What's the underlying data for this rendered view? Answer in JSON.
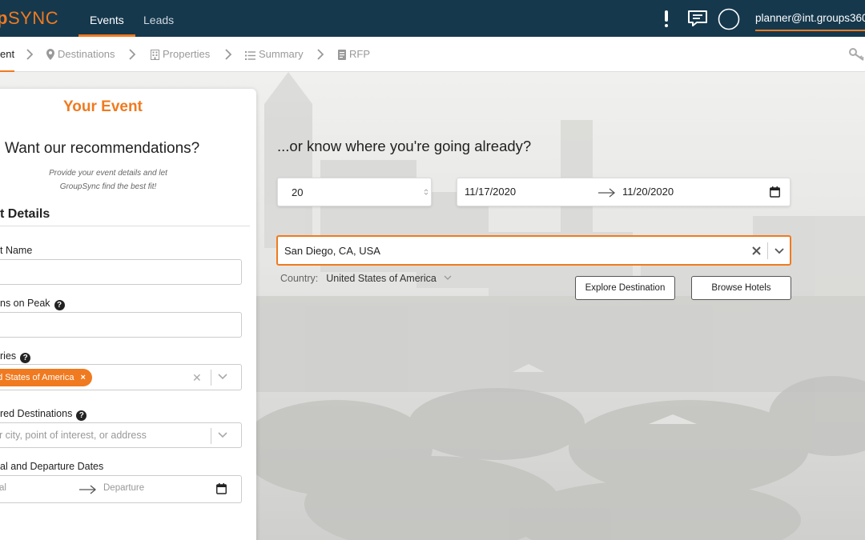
{
  "app": {
    "logo_part1": "p",
    "logo_part2": "SYNC",
    "brand_color": "#f07a1f",
    "nav_color": "#15384d"
  },
  "topnav": {
    "tabs": [
      {
        "label": "Events",
        "active": true
      },
      {
        "label": "Leads",
        "active": false
      }
    ],
    "icons": [
      "alert-icon",
      "chat-icon",
      "avatar-circle-icon"
    ],
    "user": "planner@int.groups360"
  },
  "breadcrumb": {
    "items": [
      {
        "label": "ent",
        "icon": null,
        "active": true
      },
      {
        "label": "Destinations",
        "icon": "map-pin-icon",
        "active": false
      },
      {
        "label": "Properties",
        "icon": "building-icon",
        "active": false
      },
      {
        "label": "Summary",
        "icon": "list-icon",
        "active": false
      },
      {
        "label": "RFP",
        "icon": "document-icon",
        "active": false
      }
    ],
    "right_icon": "key-icon"
  },
  "panel": {
    "title": "Your Event",
    "question": "Want our recommendations?",
    "subtitle_line1": "Provide your event details and let",
    "subtitle_line2": "GroupSync find the best fit!",
    "section": "t Details",
    "fields": {
      "name_label": "t Name",
      "peak_label": "ns on Peak",
      "countries_label": "ries",
      "country_tag": "ed States of America",
      "preferred_label": "red Destinations",
      "preferred_placeholder": "r city, point of interest, or address",
      "dates_label": "al and Departure Dates",
      "arrival_placeholder": "al",
      "departure_placeholder": "Departure"
    }
  },
  "search": {
    "question": "...or know where you're going already?",
    "rooms": "20",
    "start_date": "11/17/2020",
    "end_date": "11/20/2020",
    "location": "San Diego, CA, USA",
    "country_label": "Country:",
    "country_value": "United States of America",
    "explore_button": "Explore Destination",
    "browse_button": "Browse Hotels"
  }
}
